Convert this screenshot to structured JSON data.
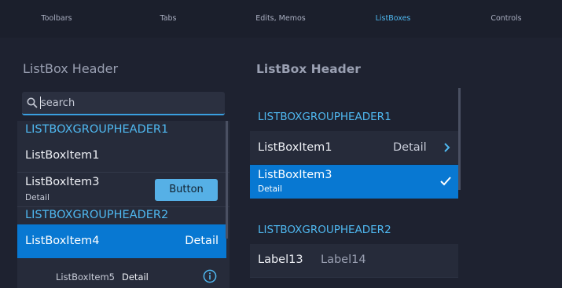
{
  "tabs": [
    {
      "label": "Toolbars"
    },
    {
      "label": "Tabs"
    },
    {
      "label": "Edits, Memos"
    },
    {
      "label": "ListBoxes"
    },
    {
      "label": "Controls"
    }
  ],
  "active_tab": "ListBoxes",
  "left": {
    "header": "ListBox Header",
    "search": {
      "value": "search"
    },
    "group1": "LISTBOXGROUPHEADER1",
    "item1": "ListBoxItem1",
    "item3": {
      "label": "ListBoxItem3",
      "sub": "Detail",
      "button": "Button"
    },
    "group2": "LISTBOXGROUPHEADER2",
    "item4": {
      "label": "ListBoxItem4",
      "detail": "Detail"
    },
    "item5": {
      "label": "ListBoxItem5",
      "detail": "Detail"
    }
  },
  "right": {
    "header": "ListBox Header",
    "group1": "LISTBOXGROUPHEADER1",
    "item1": {
      "label": "ListBoxItem1",
      "detail": "Detail"
    },
    "item3": {
      "label": "ListBoxItem3",
      "sub": "Detail"
    },
    "group2": "LISTBOXGROUPHEADER2",
    "labels": {
      "a": "Label13",
      "b": "Label14"
    }
  },
  "colors": {
    "accent": "#4fb8f0",
    "selection": "#0878d2",
    "button": "#56b0e6"
  },
  "icons": {
    "search": "search-icon",
    "info": "info-icon",
    "chevron": "chevron-right-icon",
    "check": "checkmark-icon"
  }
}
